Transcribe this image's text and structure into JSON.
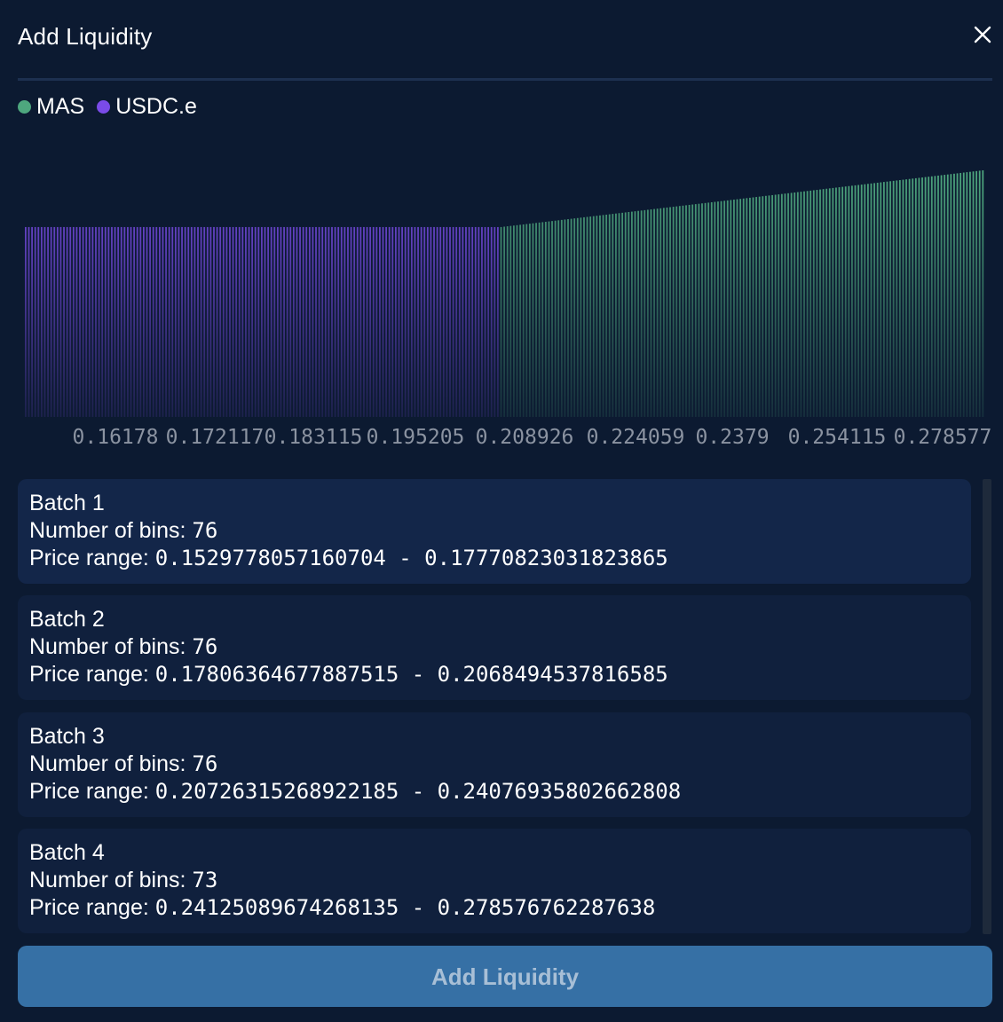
{
  "modal": {
    "title": "Add Liquidity",
    "close_icon": "close-icon"
  },
  "legend": [
    {
      "label": "MAS",
      "color": "#4ea77e"
    },
    {
      "label": "USDC.e",
      "color": "#7a4be8"
    }
  ],
  "chart_data": {
    "type": "bar",
    "series": [
      {
        "name": "USDC.e",
        "color": "#7a4be8",
        "bins": 149,
        "relative_height": 0.77
      },
      {
        "name": "MAS",
        "color": "#4ea77e",
        "bins": 152,
        "relative_height_start": 0.77,
        "relative_height_end": 1.0
      }
    ],
    "tick_labels": [
      "0.16178",
      "0.172117",
      "0.183115",
      "0.195205",
      "0.208926",
      "0.224059",
      "0.2379",
      "0.254115",
      "0.278577"
    ],
    "legend_position": "top-left",
    "grid": false
  },
  "batches": [
    {
      "title": "Batch 1",
      "bins_label": "Number of bins: ",
      "bins": "76",
      "range_label": "Price range: ",
      "range": "0.1529778057160704 - 0.17770823031823865",
      "selected": true
    },
    {
      "title": "Batch 2",
      "bins_label": "Number of bins: ",
      "bins": "76",
      "range_label": "Price range: ",
      "range": "0.17806364677887515 - 0.2068494537816585",
      "selected": false
    },
    {
      "title": "Batch 3",
      "bins_label": "Number of bins: ",
      "bins": "76",
      "range_label": "Price range: ",
      "range": "0.20726315268922185 - 0.24076935802662808",
      "selected": false
    },
    {
      "title": "Batch 4",
      "bins_label": "Number of bins: ",
      "bins": "73",
      "range_label": "Price range: ",
      "range": "0.24125089674268135 - 0.278576762287638",
      "selected": false
    }
  ],
  "footer": {
    "add_button_label": "Add Liquidity"
  }
}
